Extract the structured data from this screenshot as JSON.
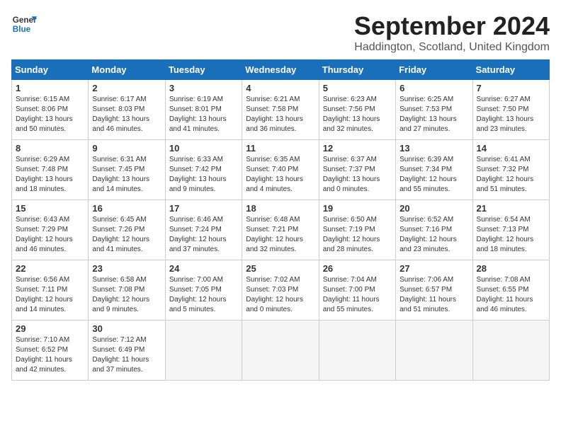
{
  "logo": {
    "line1": "General",
    "line2": "Blue"
  },
  "title": "September 2024",
  "location": "Haddington, Scotland, United Kingdom",
  "days_of_week": [
    "Sunday",
    "Monday",
    "Tuesday",
    "Wednesday",
    "Thursday",
    "Friday",
    "Saturday"
  ],
  "weeks": [
    [
      {
        "day": "1",
        "sunrise": "Sunrise: 6:15 AM",
        "sunset": "Sunset: 8:06 PM",
        "daylight": "Daylight: 13 hours and 50 minutes."
      },
      {
        "day": "2",
        "sunrise": "Sunrise: 6:17 AM",
        "sunset": "Sunset: 8:03 PM",
        "daylight": "Daylight: 13 hours and 46 minutes."
      },
      {
        "day": "3",
        "sunrise": "Sunrise: 6:19 AM",
        "sunset": "Sunset: 8:01 PM",
        "daylight": "Daylight: 13 hours and 41 minutes."
      },
      {
        "day": "4",
        "sunrise": "Sunrise: 6:21 AM",
        "sunset": "Sunset: 7:58 PM",
        "daylight": "Daylight: 13 hours and 36 minutes."
      },
      {
        "day": "5",
        "sunrise": "Sunrise: 6:23 AM",
        "sunset": "Sunset: 7:56 PM",
        "daylight": "Daylight: 13 hours and 32 minutes."
      },
      {
        "day": "6",
        "sunrise": "Sunrise: 6:25 AM",
        "sunset": "Sunset: 7:53 PM",
        "daylight": "Daylight: 13 hours and 27 minutes."
      },
      {
        "day": "7",
        "sunrise": "Sunrise: 6:27 AM",
        "sunset": "Sunset: 7:50 PM",
        "daylight": "Daylight: 13 hours and 23 minutes."
      }
    ],
    [
      {
        "day": "8",
        "sunrise": "Sunrise: 6:29 AM",
        "sunset": "Sunset: 7:48 PM",
        "daylight": "Daylight: 13 hours and 18 minutes."
      },
      {
        "day": "9",
        "sunrise": "Sunrise: 6:31 AM",
        "sunset": "Sunset: 7:45 PM",
        "daylight": "Daylight: 13 hours and 14 minutes."
      },
      {
        "day": "10",
        "sunrise": "Sunrise: 6:33 AM",
        "sunset": "Sunset: 7:42 PM",
        "daylight": "Daylight: 13 hours and 9 minutes."
      },
      {
        "day": "11",
        "sunrise": "Sunrise: 6:35 AM",
        "sunset": "Sunset: 7:40 PM",
        "daylight": "Daylight: 13 hours and 4 minutes."
      },
      {
        "day": "12",
        "sunrise": "Sunrise: 6:37 AM",
        "sunset": "Sunset: 7:37 PM",
        "daylight": "Daylight: 13 hours and 0 minutes."
      },
      {
        "day": "13",
        "sunrise": "Sunrise: 6:39 AM",
        "sunset": "Sunset: 7:34 PM",
        "daylight": "Daylight: 12 hours and 55 minutes."
      },
      {
        "day": "14",
        "sunrise": "Sunrise: 6:41 AM",
        "sunset": "Sunset: 7:32 PM",
        "daylight": "Daylight: 12 hours and 51 minutes."
      }
    ],
    [
      {
        "day": "15",
        "sunrise": "Sunrise: 6:43 AM",
        "sunset": "Sunset: 7:29 PM",
        "daylight": "Daylight: 12 hours and 46 minutes."
      },
      {
        "day": "16",
        "sunrise": "Sunrise: 6:45 AM",
        "sunset": "Sunset: 7:26 PM",
        "daylight": "Daylight: 12 hours and 41 minutes."
      },
      {
        "day": "17",
        "sunrise": "Sunrise: 6:46 AM",
        "sunset": "Sunset: 7:24 PM",
        "daylight": "Daylight: 12 hours and 37 minutes."
      },
      {
        "day": "18",
        "sunrise": "Sunrise: 6:48 AM",
        "sunset": "Sunset: 7:21 PM",
        "daylight": "Daylight: 12 hours and 32 minutes."
      },
      {
        "day": "19",
        "sunrise": "Sunrise: 6:50 AM",
        "sunset": "Sunset: 7:19 PM",
        "daylight": "Daylight: 12 hours and 28 minutes."
      },
      {
        "day": "20",
        "sunrise": "Sunrise: 6:52 AM",
        "sunset": "Sunset: 7:16 PM",
        "daylight": "Daylight: 12 hours and 23 minutes."
      },
      {
        "day": "21",
        "sunrise": "Sunrise: 6:54 AM",
        "sunset": "Sunset: 7:13 PM",
        "daylight": "Daylight: 12 hours and 18 minutes."
      }
    ],
    [
      {
        "day": "22",
        "sunrise": "Sunrise: 6:56 AM",
        "sunset": "Sunset: 7:11 PM",
        "daylight": "Daylight: 12 hours and 14 minutes."
      },
      {
        "day": "23",
        "sunrise": "Sunrise: 6:58 AM",
        "sunset": "Sunset: 7:08 PM",
        "daylight": "Daylight: 12 hours and 9 minutes."
      },
      {
        "day": "24",
        "sunrise": "Sunrise: 7:00 AM",
        "sunset": "Sunset: 7:05 PM",
        "daylight": "Daylight: 12 hours and 5 minutes."
      },
      {
        "day": "25",
        "sunrise": "Sunrise: 7:02 AM",
        "sunset": "Sunset: 7:03 PM",
        "daylight": "Daylight: 12 hours and 0 minutes."
      },
      {
        "day": "26",
        "sunrise": "Sunrise: 7:04 AM",
        "sunset": "Sunset: 7:00 PM",
        "daylight": "Daylight: 11 hours and 55 minutes."
      },
      {
        "day": "27",
        "sunrise": "Sunrise: 7:06 AM",
        "sunset": "Sunset: 6:57 PM",
        "daylight": "Daylight: 11 hours and 51 minutes."
      },
      {
        "day": "28",
        "sunrise": "Sunrise: 7:08 AM",
        "sunset": "Sunset: 6:55 PM",
        "daylight": "Daylight: 11 hours and 46 minutes."
      }
    ],
    [
      {
        "day": "29",
        "sunrise": "Sunrise: 7:10 AM",
        "sunset": "Sunset: 6:52 PM",
        "daylight": "Daylight: 11 hours and 42 minutes."
      },
      {
        "day": "30",
        "sunrise": "Sunrise: 7:12 AM",
        "sunset": "Sunset: 6:49 PM",
        "daylight": "Daylight: 11 hours and 37 minutes."
      },
      null,
      null,
      null,
      null,
      null
    ]
  ]
}
